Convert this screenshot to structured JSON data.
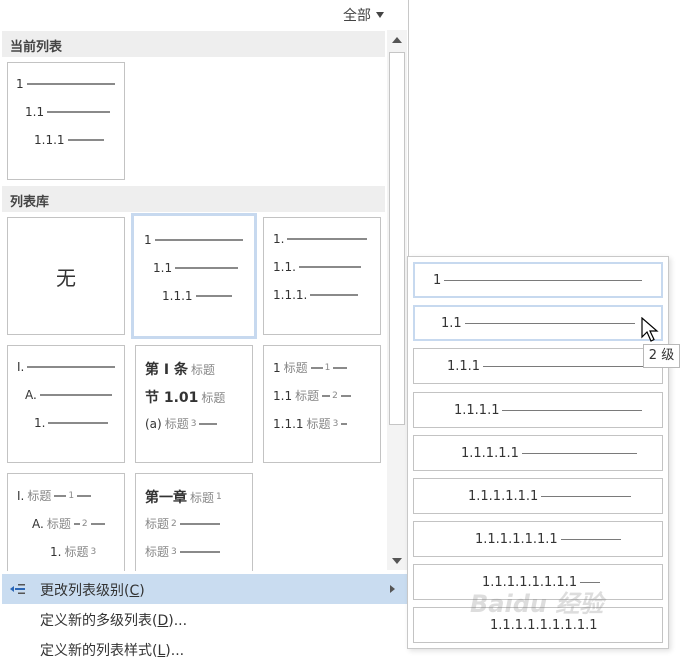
{
  "filter": {
    "label": "全部"
  },
  "sections": {
    "current": "当前列表",
    "library": "列表库"
  },
  "current_list": {
    "rows": [
      "1",
      "1.1",
      "1.1.1"
    ]
  },
  "library": {
    "none": "无",
    "t1": [
      "1",
      "1.1",
      "1.1.1"
    ],
    "t2": [
      "1.",
      "1.1.",
      "1.1.1."
    ],
    "t3": [
      "I.",
      "A.",
      "1."
    ],
    "t4": {
      "r1a": "第 I 条",
      "r1b": "标题",
      "r2a": "节 1.01",
      "r2b": "标题",
      "r3a": "(a)",
      "r3b": "标题",
      "r3c": "3"
    },
    "t5": {
      "r1a": "1",
      "r1b": "标题",
      "r1c": "1",
      "r2a": "1.1",
      "r2b": "标题",
      "r2c": "2",
      "r3a": "1.1.1",
      "r3b": "标题",
      "r3c": "3"
    },
    "t6": {
      "r1a": "I.",
      "r1b": "标题",
      "r1c": "1",
      "r2a": "A.",
      "r2b": "标题",
      "r2c": "2",
      "r3a": "1.",
      "r3b": "标题",
      "r3c": "3"
    },
    "t7": {
      "r1a": "第一章",
      "r1b": "标题",
      "r1c": "1",
      "r2b": "标题",
      "r2c": "2",
      "r3b": "标题",
      "r3c": "3"
    }
  },
  "menu": {
    "change_level": {
      "text": "更改列表级别(",
      "key": "C",
      "end": ")"
    },
    "define_multilevel": {
      "text": "定义新的多级列表(",
      "key": "D",
      "end": ")..."
    },
    "define_style": {
      "text": "定义新的列表样式(",
      "key": "L",
      "end": ")..."
    }
  },
  "levels": [
    "1",
    "1.1",
    "1.1.1",
    "1.1.1.1",
    "1.1.1.1.1",
    "1.1.1.1.1.1",
    "1.1.1.1.1.1.1",
    "1.1.1.1.1.1.1.1",
    "1.1.1.1.1.1.1.1.1"
  ],
  "tooltip": "2 级",
  "watermark": "Baidu 经验",
  "colors": {
    "highlight": "#c9dcf0",
    "selected_border": "#c7d9ef",
    "section_bg": "#eeeeee"
  }
}
